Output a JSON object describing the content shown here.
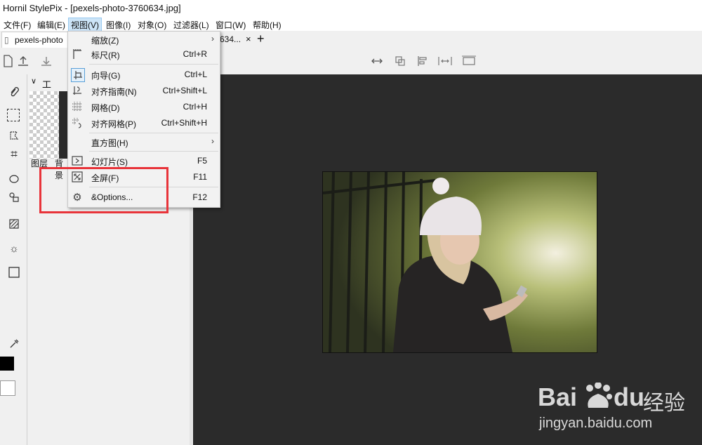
{
  "window": {
    "title": "Hornil StylePix - [pexels-photo-3760634.jpg]"
  },
  "menubar": [
    "文件(F)",
    "编辑(E)",
    "视图(V)",
    "图像(I)",
    "对象(O)",
    "过滤器(L)",
    "窗口(W)",
    "帮助(H)"
  ],
  "tabs": {
    "first": "pexels-photo",
    "second": "634...",
    "close": "×",
    "add": "+"
  },
  "panel": {
    "title": "工具选",
    "tab_layers": "图层",
    "tab_bg": "背景"
  },
  "view_menu": {
    "zoom": {
      "label": "缩放(Z)",
      "icon": "zoom-icon"
    },
    "ruler": {
      "label": "标尺(R)",
      "shortcut": "Ctrl+R",
      "icon": "ruler-icon"
    },
    "guides": {
      "label": "向导(G)",
      "shortcut": "Ctrl+L",
      "icon": "guides-icon"
    },
    "snap_guides": {
      "label": "对齐指南(N)",
      "shortcut": "Ctrl+Shift+L",
      "icon": "snap-guides-icon"
    },
    "grid": {
      "label": "网格(D)",
      "shortcut": "Ctrl+H",
      "icon": "grid-icon"
    },
    "snap_grid": {
      "label": "对齐网格(P)",
      "shortcut": "Ctrl+Shift+H",
      "icon": "snap-grid-icon"
    },
    "histogram": {
      "label": "直方图(H)"
    },
    "slideshow": {
      "label": "幻灯片(S)",
      "shortcut": "F5",
      "icon": "slideshow-icon"
    },
    "fullscreen": {
      "label": "全屏(F)",
      "shortcut": "F11",
      "icon": "fullscreen-icon"
    },
    "options": {
      "label": "&Options...",
      "shortcut": "F12",
      "icon": "gear-icon"
    }
  },
  "watermark": {
    "brand_a": "Bai",
    "brand_b": "du",
    "brand_cn": "经验",
    "url": "jingyan.baidu.com"
  },
  "colors": {
    "highlight": "#e8343a",
    "canvas": "#2b2b2b",
    "menu_active": "#cce4f7"
  }
}
